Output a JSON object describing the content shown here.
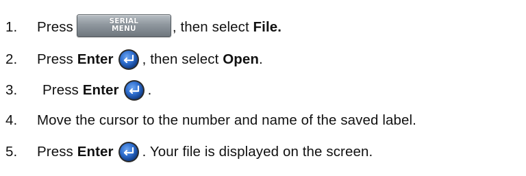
{
  "steps": [
    {
      "number": "1.",
      "text_before": "Press",
      "key": {
        "line1": "SERIAL",
        "line2": "MENU",
        "icon": "serial-menu-key"
      },
      "text_middle": ", then select",
      "bold_end": "File."
    },
    {
      "number": "2.",
      "text_before": "Press",
      "bold_key_label": "Enter",
      "key_icon": "enter-key",
      "text_middle": ", then select",
      "bold_end": "Open",
      "text_end": "."
    },
    {
      "number": "3.",
      "text_before": "Press",
      "bold_key_label": "Enter",
      "key_icon": "enter-key",
      "text_end": "."
    },
    {
      "number": "4.",
      "text": "Move the cursor to the number and name of the saved label."
    },
    {
      "number": "5.",
      "text_before": "Press",
      "bold_key_label": "Enter",
      "key_icon": "enter-key",
      "text_end": ". Your file is displayed on the screen."
    }
  ],
  "colors": {
    "enter_key_blue": "#2f6fd0",
    "keycap_gray": "#8f979e"
  }
}
